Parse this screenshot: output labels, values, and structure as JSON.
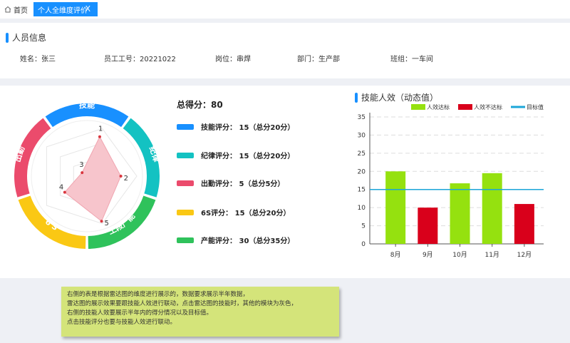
{
  "tabs": {
    "home_label": "首页",
    "active_label": "个人全维度评价",
    "close_glyph": "X"
  },
  "personnel": {
    "section_title": "人员信息",
    "fields": [
      {
        "label": "姓名：",
        "value": "张三"
      },
      {
        "label": "员工工号：",
        "value": "20221022"
      },
      {
        "label": "岗位：",
        "value": "串焊"
      },
      {
        "label": "部门：",
        "value": "生产部"
      },
      {
        "label": "班组：",
        "value": "一车间"
      }
    ]
  },
  "radar": {
    "segments": [
      {
        "label": "技能",
        "color": "#1890ff"
      },
      {
        "label": "纪律",
        "color": "#13c2c2"
      },
      {
        "label": "工段产能",
        "color": "#2fc25b"
      },
      {
        "label": "6 S",
        "color": "#fac814"
      },
      {
        "label": "出勤",
        "color": "#eb4b6c"
      }
    ],
    "points": [
      {
        "label": "1",
        "value": 0.83
      },
      {
        "label": "2",
        "value": 0.68
      },
      {
        "label": "5",
        "value": 0.95
      },
      {
        "label": "4",
        "value": 0.55
      },
      {
        "label": "3",
        "value": 0.12
      }
    ],
    "fill": "#f7c5cc",
    "point_color": "#d9363e"
  },
  "scores": {
    "total_label": "总得分：",
    "total_value": "80",
    "items": [
      {
        "text": "技能评分：  15（总分20分）",
        "color": "#1890ff"
      },
      {
        "text": "纪律评分：  15（总分20分）",
        "color": "#13c2c2"
      },
      {
        "text": "出勤评分：  5（总分5分）",
        "color": "#eb4b6c"
      },
      {
        "text": "6S评分：  15（总分20分）",
        "color": "#fac814"
      },
      {
        "text": "产能评分：  30（总分35分）",
        "color": "#2fc25b"
      }
    ]
  },
  "chart_data": {
    "type": "bar",
    "title": "技能人效（动态值）",
    "categories": [
      "8月",
      "9月",
      "10月",
      "11月",
      "12月"
    ],
    "series": [
      {
        "name": "人效达标",
        "color": "#95e10f"
      },
      {
        "name": "人效不达标",
        "color": "#d9001b"
      }
    ],
    "values": [
      20,
      10,
      16.7,
      19.5,
      11
    ],
    "status": [
      "人效达标",
      "人效不达标",
      "人效达标",
      "人效达标",
      "人效不达标"
    ],
    "target": {
      "name": "目标值",
      "value": 15,
      "color": "#1ba6d8"
    },
    "ylim": [
      0,
      35
    ],
    "yticks": [
      "0",
      "5",
      "10",
      "15",
      "20",
      "25",
      "30",
      "35"
    ],
    "grid": true,
    "legend_position": "top-right"
  },
  "note": {
    "lines": [
      "右侧的表是根据雷达图的维度进行展示的，数据要求展示半年数据，",
      "雷达图的展示效果要跟技能人效进行联动，点击雷达图的技能时，其他的模块为灰色，",
      "右侧的技能人效要展示半年内的得分情况以及目标值。",
      "点击技能评分也要与技能人效进行联动。"
    ]
  }
}
